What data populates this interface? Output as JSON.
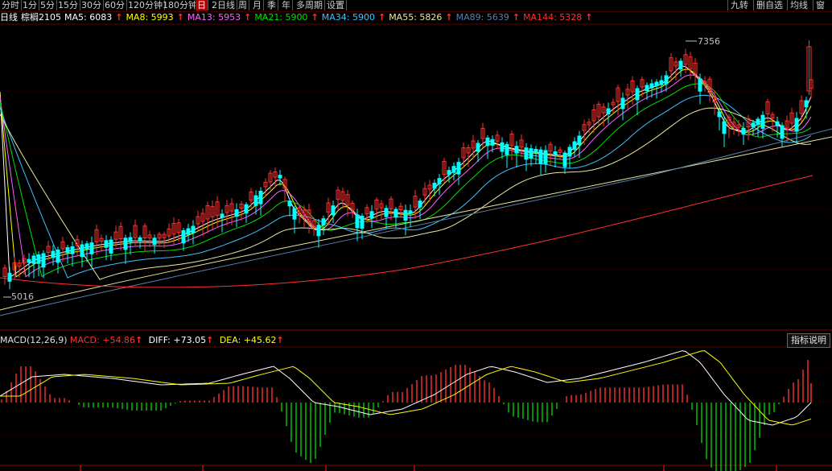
{
  "toolbar": {
    "periods": [
      "分时",
      "1分",
      "5分",
      "15分",
      "30分",
      "60分",
      "120分钟",
      "180分钟",
      "日",
      "2日线",
      "周",
      "月",
      "季",
      "年",
      "多周期",
      "设置"
    ],
    "active": "日",
    "right_tools": [
      "九转",
      "删自选",
      "均线",
      "窗"
    ]
  },
  "legend": {
    "period": "日线",
    "symbol": "棕榈2105",
    "ma": [
      {
        "label": "MA5: 6083",
        "color": "#ffffff"
      },
      {
        "label": "MA8: 5993",
        "color": "#ffff00"
      },
      {
        "label": "MA13: 5953",
        "color": "#ff60ff"
      },
      {
        "label": "MA21: 5900",
        "color": "#00e000"
      },
      {
        "label": "MA34: 5900",
        "color": "#40c0ff"
      },
      {
        "label": "MA55: 5826",
        "color": "#e8e8a0"
      },
      {
        "label": "MA89: 5639",
        "color": "#5a7fa8"
      },
      {
        "label": "MA144: 5328",
        "color": "#ff3030"
      }
    ]
  },
  "price_tags": {
    "high": "7356",
    "low": "5016"
  },
  "macd_legend": {
    "title": "MACD(12,26,9)",
    "macd": "MACD: +54.86",
    "diff": "DIFF: +73.05",
    "dea": "DEA: +45.62"
  },
  "indicator_button": "指标说明",
  "colors": {
    "up": "#ff3030",
    "down": "#00ffff",
    "macd_up": "#ff3030",
    "macd_down": "#00d000"
  }
}
